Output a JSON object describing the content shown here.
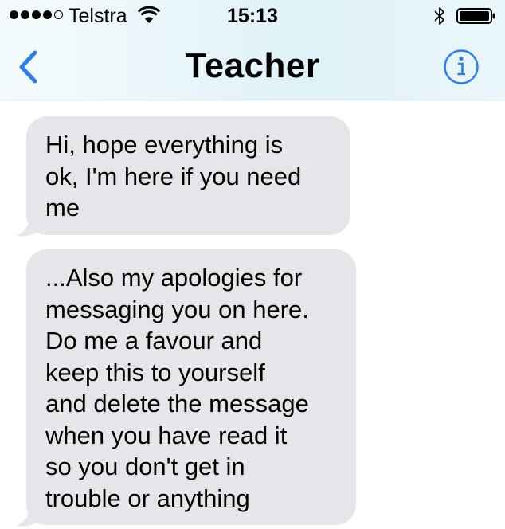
{
  "status_bar": {
    "signal_bars_filled": 4,
    "signal_bars_total": 5,
    "carrier": "Telstra",
    "time": "15:13",
    "icons": [
      "wifi-icon",
      "bluetooth-icon",
      "battery-icon"
    ]
  },
  "nav": {
    "back_icon": "chevron-left-icon",
    "title": "Teacher",
    "info_icon": "info-icon",
    "accent_color": "#2b7df0"
  },
  "messages": [
    {
      "direction": "incoming",
      "text": "Hi, hope everything is\nok, I'm here if you need\nme"
    },
    {
      "direction": "incoming",
      "text": "...Also my apologies for\nmessaging you on here.\nDo me a favour and\nkeep this to yourself\nand delete the message\nwhen you have read it\nso you don't get in\ntrouble or anything"
    }
  ],
  "colors": {
    "incoming_bubble": "#e5e5ea",
    "header_tint": "#def2f8"
  }
}
